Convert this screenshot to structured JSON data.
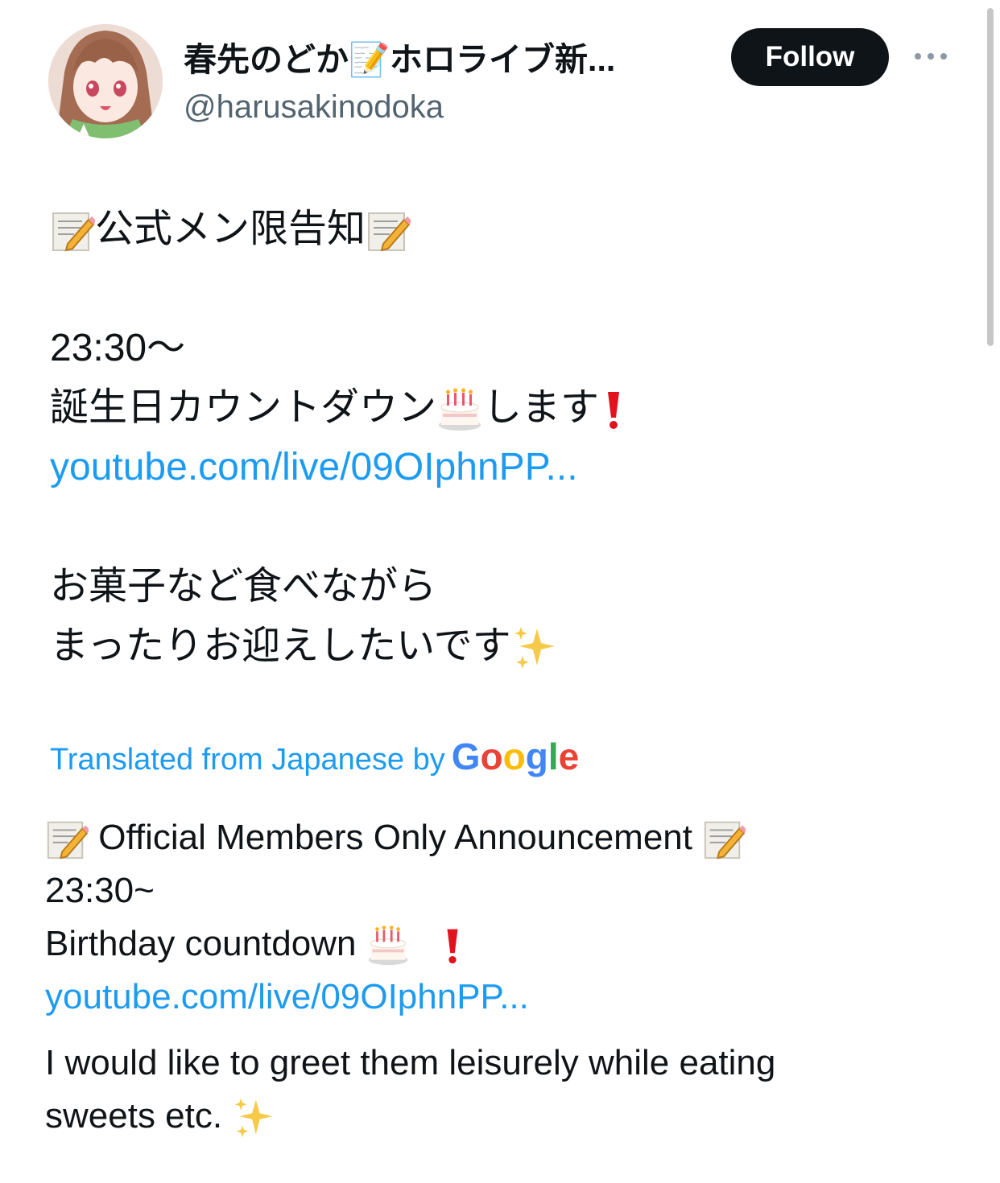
{
  "header": {
    "display_name": "春先のどか📝ホロライブ新...",
    "handle": "@harusakinodoka",
    "follow_label": "Follow",
    "more_icon": "more-horizontal-icon"
  },
  "tweet_ja": {
    "line1_text": "公式メン限告知",
    "line2": "23:30～",
    "line3_text": "誕生日カウントダウン",
    "line3_after": "します",
    "link": "youtube.com/live/09OIphnPP...",
    "line5": "お菓子など食べながら",
    "line6_text": "まったりお迎えしたいです"
  },
  "translation": {
    "label": "Translated from Japanese by",
    "brand": "Google",
    "line1_text": "Official Members Only Announcement",
    "line2": "23:30~",
    "line3_text": "Birthday countdown",
    "link": "youtube.com/live/09OIphnPP...",
    "line5": "I would like to greet them leisurely while eating",
    "line6_text": "sweets etc."
  },
  "icons": [
    "memo-icon",
    "birthday-cake-icon",
    "exclamation-icon",
    "sparkles-icon"
  ],
  "colors": {
    "link": "#1d9bf0",
    "follow_bg": "#0f1419",
    "handle": "#536471",
    "text": "#0f1419"
  }
}
